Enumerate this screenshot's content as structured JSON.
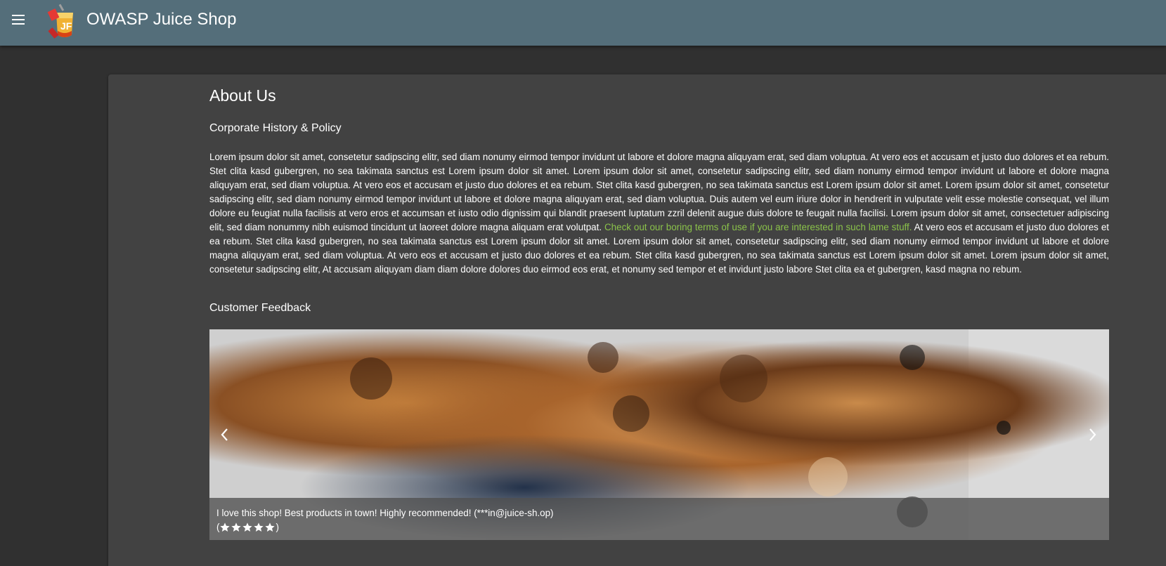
{
  "header": {
    "title": "OWASP Juice Shop",
    "menu_icon": "hamburger-menu-icon",
    "logo_icon": "juice-shop-logo"
  },
  "about": {
    "title": "About Us",
    "history_title": "Corporate History & Policy",
    "paragraph_before_link": "Lorem ipsum dolor sit amet, consetetur sadipscing elitr, sed diam nonumy eirmod tempor invidunt ut labore et dolore magna aliquyam erat, sed diam voluptua. At vero eos et accusam et justo duo dolores et ea rebum. Stet clita kasd gubergren, no sea takimata sanctus est Lorem ipsum dolor sit amet. Lorem ipsum dolor sit amet, consetetur sadipscing elitr, sed diam nonumy eirmod tempor invidunt ut labore et dolore magna aliquyam erat, sed diam voluptua. At vero eos et accusam et justo duo dolores et ea rebum. Stet clita kasd gubergren, no sea takimata sanctus est Lorem ipsum dolor sit amet. Lorem ipsum dolor sit amet, consetetur sadipscing elitr, sed diam nonumy eirmod tempor invidunt ut labore et dolore magna aliquyam erat, sed diam voluptua. Duis autem vel eum iriure dolor in hendrerit in vulputate velit esse molestie consequat, vel illum dolore eu feugiat nulla facilisis at vero eros et accumsan et iusto odio dignissim qui blandit praesent luptatum zzril delenit augue duis dolore te feugait nulla facilisi. Lorem ipsum dolor sit amet, consectetuer adipiscing elit, sed diam nonummy nibh euismod tincidunt ut laoreet dolore magna aliquam erat volutpat. ",
    "link_text": "Check out our boring terms of use if you are interested in such lame stuff.",
    "paragraph_after_link": " At vero eos et accusam et justo duo dolores et ea rebum. Stet clita kasd gubergren, no sea takimata sanctus est Lorem ipsum dolor sit amet. Lorem ipsum dolor sit amet, consetetur sadipscing elitr, sed diam nonumy eirmod tempor invidunt ut labore et dolore magna aliquyam erat, sed diam voluptua. At vero eos et accusam et justo duo dolores et ea rebum. Stet clita kasd gubergren, no sea takimata sanctus est Lorem ipsum dolor sit amet. Lorem ipsum dolor sit amet, consetetur sadipscing elitr, At accusam aliquyam diam diam dolore dolores duo eirmod eos erat, et nonumy sed tempor et et invidunt justo labore Stet clita ea et gubergren, kasd magna no rebum.",
    "feedback_title": "Customer Feedback"
  },
  "carousel": {
    "prev_icon": "chevron-left-icon",
    "next_icon": "chevron-right-icon",
    "caption": "I love this shop! Best products in town! Highly recommended! (***in@juice-sh.op)",
    "rating_open": "(",
    "rating_close": ")",
    "rating_stars": 5,
    "rating_max": 5,
    "star_icon": "star-icon"
  },
  "colors": {
    "toolbar": "#546e7a",
    "background": "#303030",
    "card": "#424242",
    "link": "#8bc34a"
  }
}
